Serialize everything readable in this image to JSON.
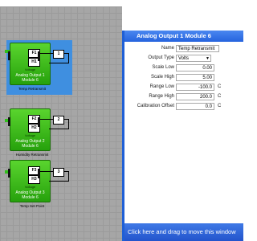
{
  "window": {
    "title": "Analog Output 1 Module 6",
    "drag_hint": "Click here and drag to move this window"
  },
  "properties": {
    "name": {
      "label": "Name",
      "value": "Temp Retransmit"
    },
    "output_type": {
      "label": "Output Type",
      "value": "Volts"
    },
    "scale_low": {
      "label": "Scale Low",
      "value": "0.00"
    },
    "scale_high": {
      "label": "Scale High",
      "value": "5.00"
    },
    "range_low": {
      "label": "Range Low",
      "value": "-100.0",
      "unit": "C"
    },
    "range_high": {
      "label": "Range High",
      "value": "200.0",
      "unit": "C"
    },
    "calibration_offset": {
      "label": "Calibration Offset",
      "value": "0.0",
      "unit": "C"
    }
  },
  "blocks": [
    {
      "pin_top": "F1",
      "pin_bottom": "H1",
      "signal": "Voltage",
      "line1": "Analog Output 1",
      "line2": "Module 6",
      "output": "1",
      "caption": "Temp Retransmit"
    },
    {
      "pin_top": "F2",
      "pin_bottom": "H2",
      "signal": "Voltage",
      "line1": "Analog Output 2",
      "line2": "Module 6",
      "output": "2",
      "caption": "Humidity Retransmit"
    },
    {
      "pin_top": "F3",
      "pin_bottom": "H3",
      "signal": "Voltage",
      "line1": "Analog Output 3",
      "line2": "Module 6",
      "output": "3",
      "caption": "Temp Set Point"
    }
  ],
  "colors": {
    "titlebar": "#2f6fe6",
    "block_green": "#3cc01e",
    "selection": "#3f8fe0",
    "canvas": "#a6a6a6"
  }
}
